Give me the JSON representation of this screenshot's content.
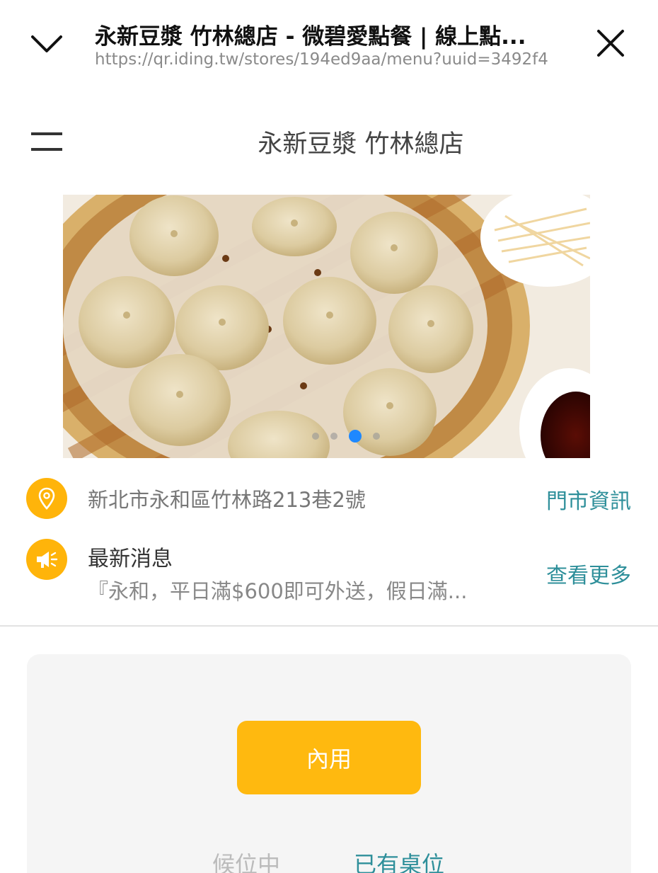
{
  "browser": {
    "title": "永新豆漿 竹林總店 - 微碧愛點餐 | 線上點...",
    "url": "https://qr.iding.tw/stores/194ed9aa/menu?uuid=3492f4"
  },
  "header": {
    "store_name": "永新豆漿 竹林總店"
  },
  "banner": {
    "image_alt": "soup-dumplings-photo",
    "slides": 4,
    "active_slide": 3
  },
  "info": {
    "address": "新北市永和區竹林路213巷2號",
    "store_info_label": "門市資訊",
    "news_title": "最新消息",
    "news_text": "『永和，平日滿$600即可外送，假日滿...",
    "more_label": "查看更多"
  },
  "order": {
    "dine_in_label": "內用",
    "waiting_label": "候位中",
    "has_table_label": "已有桌位"
  },
  "colors": {
    "accent": "#ffb90f",
    "link": "#2e8f9a",
    "active_dot": "#1e88ff"
  }
}
